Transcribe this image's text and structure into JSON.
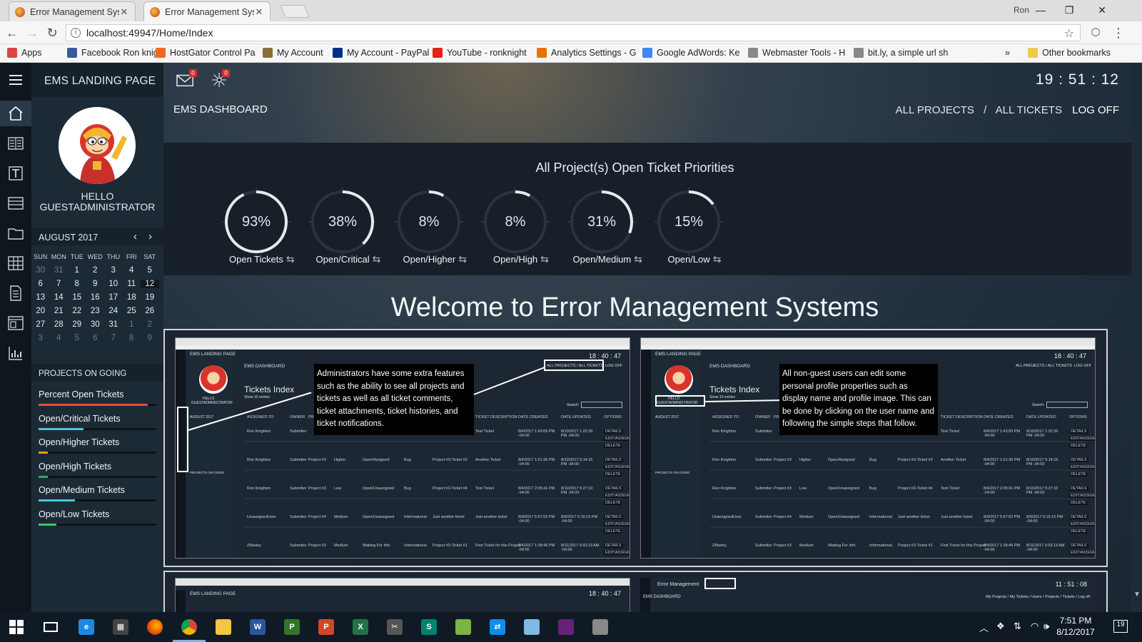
{
  "browser": {
    "tabs": [
      {
        "title": "Error Management Syste",
        "active": false
      },
      {
        "title": "Error Management Syste",
        "active": true
      }
    ],
    "user": "Ron",
    "url": "localhost:49947/Home/Index",
    "bookmarks": [
      {
        "label": "Apps",
        "icon": "apps-grid-icon",
        "color": "#d44"
      },
      {
        "label": "Facebook Ron knight",
        "icon": "facebook-icon",
        "color": "#3b5998"
      },
      {
        "label": "HostGator Control Pa",
        "icon": "hostgator-icon",
        "color": "#f26722"
      },
      {
        "label": "My Account",
        "icon": "account-icon",
        "color": "#8a6d3b"
      },
      {
        "label": "My Account - PayPal",
        "icon": "paypal-icon",
        "color": "#003087"
      },
      {
        "label": "YouTube - ronknight",
        "icon": "youtube-icon",
        "color": "#e62117"
      },
      {
        "label": "Analytics Settings - G",
        "icon": "analytics-icon",
        "color": "#e37400"
      },
      {
        "label": "Google AdWords: Ke",
        "icon": "adwords-icon",
        "color": "#4285f4"
      },
      {
        "label": "Webmaster Tools - H",
        "icon": "page-icon",
        "color": "#888888"
      },
      {
        "label": "bit.ly, a simple url sh",
        "icon": "page-icon",
        "color": "#888888"
      }
    ],
    "more": "»",
    "other_bookmarks": "Other bookmarks"
  },
  "app": {
    "landing_title": "EMS LANDING PAGE",
    "mail_badge": "0",
    "notify_badge": "0",
    "clock": "19 : 51 : 12",
    "dashboard_label": "EMS DASHBOARD",
    "nav": {
      "all_projects": "ALL PROJECTS",
      "separator": "/",
      "all_tickets": "ALL TICKETS",
      "log_off": "LOG OFF"
    },
    "user_greeting_line1": "HELLO",
    "user_greeting_line2": "GUESTADMINISTRATOR",
    "calendar": {
      "title": "AUGUST 2017",
      "nav": "‹ ›",
      "days": [
        "SUN",
        "MON",
        "TUE",
        "WED",
        "THU",
        "FRI",
        "SAT"
      ],
      "weeks": [
        [
          "30",
          "31",
          "1",
          "2",
          "3",
          "4",
          "5"
        ],
        [
          "6",
          "7",
          "8",
          "9",
          "10",
          "11",
          "12"
        ],
        [
          "13",
          "14",
          "15",
          "16",
          "17",
          "18",
          "19"
        ],
        [
          "20",
          "21",
          "22",
          "23",
          "24",
          "25",
          "26"
        ],
        [
          "27",
          "28",
          "29",
          "30",
          "31",
          "1",
          "2"
        ],
        [
          "3",
          "4",
          "5",
          "6",
          "7",
          "8",
          "9"
        ]
      ],
      "today": "12"
    },
    "projects_heading": "PROJECTS ON GOING",
    "projects": [
      {
        "label": "Percent Open Tickets",
        "fraction": 0.93,
        "color": "#e74c3c"
      },
      {
        "label": "Open/Critical Tickets",
        "fraction": 0.38,
        "color": "#4fc3d6"
      },
      {
        "label": "Open/Higher Tickets",
        "fraction": 0.08,
        "color": "#f39c12"
      },
      {
        "label": "Open/High Tickets",
        "fraction": 0.08,
        "color": "#27ae60"
      },
      {
        "label": "Open/Medium Tickets",
        "fraction": 0.31,
        "color": "#4fc3d6"
      },
      {
        "label": "Open/Low Tickets",
        "fraction": 0.15,
        "color": "#2ecc71"
      }
    ],
    "priorities_title": "All Project(s) Open Ticket Priorities",
    "gauges": [
      {
        "label": "93%",
        "fraction": 0.93,
        "caption": "Open Tickets"
      },
      {
        "label": "38%",
        "fraction": 0.38,
        "caption": "Open/Critical"
      },
      {
        "label": "8%",
        "fraction": 0.08,
        "caption": "Open/Higher"
      },
      {
        "label": "8%",
        "fraction": 0.08,
        "caption": "Open/High"
      },
      {
        "label": "31%",
        "fraction": 0.31,
        "caption": "Open/Medium"
      },
      {
        "label": "15%",
        "fraction": 0.15,
        "caption": "Open/Low"
      }
    ],
    "welcome": "Welcome to Error Management Systems",
    "screens": [
      {
        "clock": "18 : 40 : 47",
        "title": "Tickets Index",
        "callout": "Administrators have some extra features such as the ability to see all projects and tickets as well as all ticket comments, ticket attachments, ticket histories, and ticket notifications."
      },
      {
        "clock": "18 : 40 : 47",
        "title": "Tickets Index",
        "callout": "All non-guest users can edit some personal profile properties such as display name and profile image. This can be done by clicking on the user name and following the  simple steps that follow."
      }
    ],
    "mini_labels": {
      "landing": "EMS LANDING PAGE",
      "dashboard": "EMS DASHBOARD",
      "all_projects_tickets": "ALL PROJECTS / ALL TICKETS",
      "log_off": "LOG OFF",
      "hello": "HELLO",
      "user": "GUESTADMINISTRATOR",
      "month": "AUGUST 2017",
      "projects": "PROJECTS ON GOING",
      "search": "Search:",
      "show": "Show",
      "show_count": "10",
      "entries": "entries",
      "second_title": "Error Management",
      "second_dashboard": "EMS DASHBOARD",
      "second_clock": "11 : 51 : 08",
      "second_nav": "My Projects  /  My Tickets  /  Users  /  Projects  /  Tickets  /  Log off"
    },
    "mini_columns": [
      "ASSIGNED TO",
      "OWNER",
      "PROJECT NAME",
      "PRIORITY",
      "STATUS",
      "TYPE",
      "TICKET TITLE",
      "TICKET DESCRIPTION",
      "DATE CREATED",
      "DATE UPDATED",
      "OPTIONS"
    ],
    "mini_rows": [
      [
        "Ron Knighton",
        "Submitter",
        "",
        "",
        "",
        "",
        "",
        "Test Ticket",
        "8/4/2017 1:43:05 PM -04:00",
        "8/10/2017 1:22:39 PM -04:00"
      ],
      [
        "Ron Knighton",
        "Submitter",
        "Project #3",
        "Higher",
        "Open/Assigned",
        "Bug",
        "Project #3-Ticket #3",
        "Another Ticket",
        "8/4/2017 1:51:36 PM -04:00",
        "8/10/2017 5:14:15 PM -04:00"
      ],
      [
        "Ron Knighton",
        "Submitter",
        "Project #3",
        "Low",
        "Open/Unassigned",
        "Bug",
        "Project #3-Ticket #4",
        "Test Ticket",
        "8/4/2017 2:05:41 PM -04:00",
        "8/10/2017 5:27:10 PM -04:00"
      ],
      [
        "UnassignedUser",
        "Submitter",
        "Project #4",
        "Medium",
        "Open/Unassigned",
        "Informational",
        "Just another ticket",
        "Just another ticket",
        "8/9/2017 5:57:02 PM -04:00",
        "8/9/2017 6:16:15 PM -04:00"
      ],
      [
        "ZMarley",
        "Submitter",
        "Project #3",
        "Medium",
        "Waiting For Info",
        "Informational",
        "Project #3-Ticket #1",
        "First Ticket for this Project",
        "8/4/2017 1:38:46 PM -04:00",
        "8/11/2017 9:33:13 AM -04:00"
      ]
    ],
    "mini_options": [
      "DETAILS",
      "EDIT/ASSIGN",
      "DELETE"
    ]
  },
  "taskbar": {
    "time": "7:51 PM",
    "date": "8/12/2017",
    "notification_count": "19",
    "apps": [
      {
        "name": "start-icon",
        "glyph": "",
        "color": "transparent"
      },
      {
        "name": "task-view-icon",
        "glyph": "",
        "color": "transparent"
      },
      {
        "name": "edge-icon",
        "glyph": "e",
        "color": "#1e88e5"
      },
      {
        "name": "calculator-icon",
        "glyph": "▦",
        "color": "#444"
      },
      {
        "name": "firefox-icon",
        "glyph": "",
        "color": "#e66000"
      },
      {
        "name": "chrome-icon",
        "glyph": "",
        "color": "#34a853"
      },
      {
        "name": "explorer-icon",
        "glyph": "",
        "color": "#f4c542"
      },
      {
        "name": "word-icon",
        "glyph": "W",
        "color": "#2b579a"
      },
      {
        "name": "project-icon",
        "glyph": "P",
        "color": "#31752f"
      },
      {
        "name": "powerpoint-icon",
        "glyph": "P",
        "color": "#d24726"
      },
      {
        "name": "excel-icon",
        "glyph": "X",
        "color": "#217346"
      },
      {
        "name": "snipping-icon",
        "glyph": "✂",
        "color": "#555"
      },
      {
        "name": "sway-icon",
        "glyph": "S",
        "color": "#008272"
      },
      {
        "name": "chart-app-icon",
        "glyph": "",
        "color": "#7cb342"
      },
      {
        "name": "teamviewer-icon",
        "glyph": "⇄",
        "color": "#0e8ee9"
      },
      {
        "name": "notes-icon",
        "glyph": "",
        "color": "#7fb9e6"
      },
      {
        "name": "visual-studio-icon",
        "glyph": "",
        "color": "#68217a"
      },
      {
        "name": "remote-icon",
        "glyph": "",
        "color": "#888"
      }
    ]
  }
}
